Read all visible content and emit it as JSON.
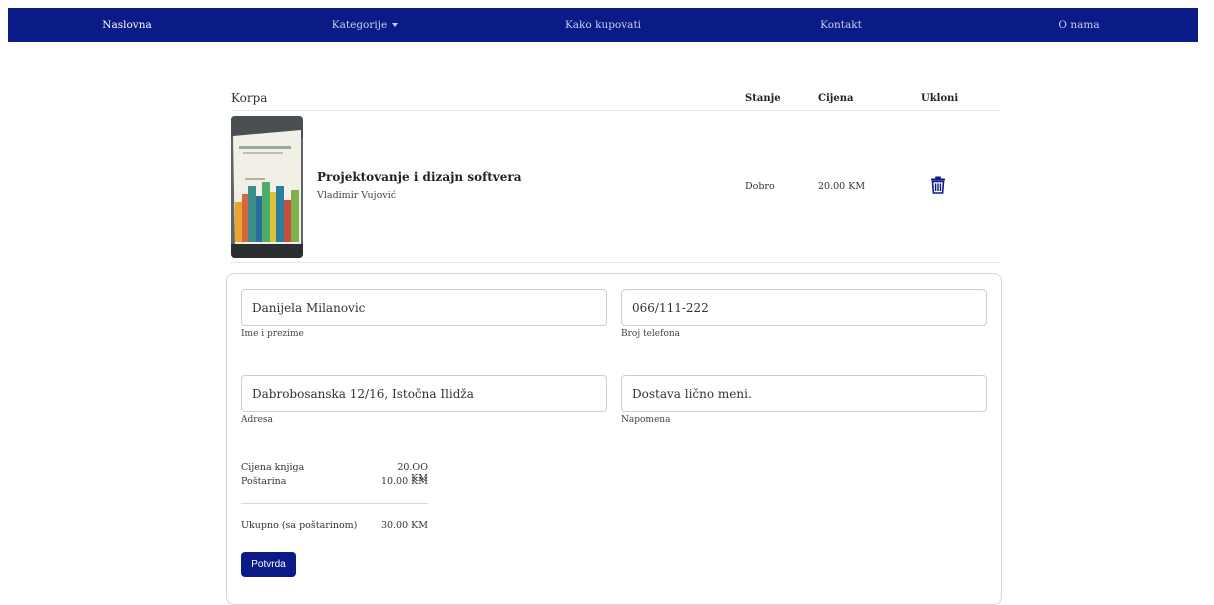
{
  "nav": {
    "items": [
      {
        "label": "Naslovna"
      },
      {
        "label": "Kategorije"
      },
      {
        "label": "Kako kupovati"
      },
      {
        "label": "Kontakt"
      },
      {
        "label": "O nama"
      }
    ]
  },
  "cart": {
    "title": "Korpa",
    "columns": {
      "condition": "Stanje",
      "price": "Cijena",
      "remove": "Ukloni"
    },
    "items": [
      {
        "title": "Projektovanje i dizajn softvera",
        "author": "Vladimir Vujović",
        "condition": "Dobro",
        "price": "20.00 KM",
        "remove_icon": "trash-icon"
      }
    ]
  },
  "form": {
    "full_name": {
      "value": "Danijela Milanovic",
      "label": "Ime i prezime"
    },
    "phone": {
      "value": "066/111-222",
      "label": "Broj telefona"
    },
    "address": {
      "value": "Dabrobosanska 12/16, Istočna Ilidža",
      "label": "Adresa"
    },
    "note": {
      "value": "Dostava lično meni.",
      "label": "Napomena"
    }
  },
  "summary": {
    "books_label": "Cijena knjiga",
    "books_value": "20.OO KM",
    "shipping_label": "Poštarina",
    "shipping_value": "10.00 KM",
    "total_label": "Ukupno (sa poštarinom)",
    "total_value": "30.00 KM"
  },
  "confirm_button": "Potvrda",
  "colors": {
    "brand": "#0a1a86"
  }
}
